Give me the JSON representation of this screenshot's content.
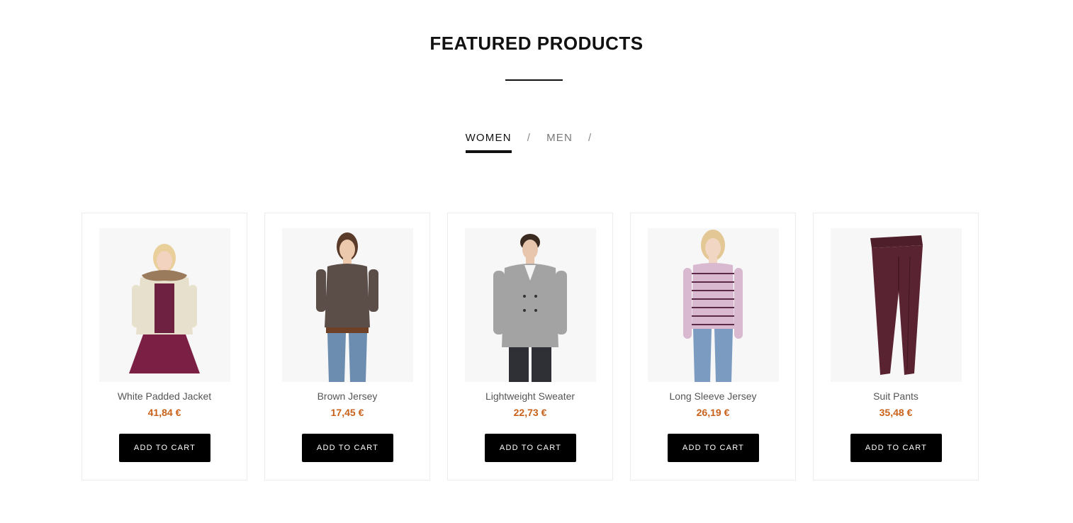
{
  "section": {
    "title": "FEATURED PRODUCTS"
  },
  "tabs": [
    {
      "label": "WOMEN",
      "active": true
    },
    {
      "label": "MEN",
      "active": false
    }
  ],
  "tab_separator": "/",
  "accent_color": "#c8611a",
  "products": [
    {
      "name": "White Padded Jacket",
      "price": "41,84 €",
      "cta": "ADD TO CART",
      "image": "woman-padded-jacket-photo"
    },
    {
      "name": "Brown Jersey",
      "price": "17,45 €",
      "cta": "ADD TO CART",
      "image": "woman-brown-jersey-photo"
    },
    {
      "name": "Lightweight Sweater",
      "price": "22,73 €",
      "cta": "ADD TO CART",
      "image": "man-grey-sweater-photo"
    },
    {
      "name": "Long Sleeve Jersey",
      "price": "26,19 €",
      "cta": "ADD TO CART",
      "image": "woman-striped-jersey-photo"
    },
    {
      "name": "Suit Pants",
      "price": "35,48 €",
      "cta": "ADD TO CART",
      "image": "burgundy-suit-pants-photo"
    }
  ]
}
